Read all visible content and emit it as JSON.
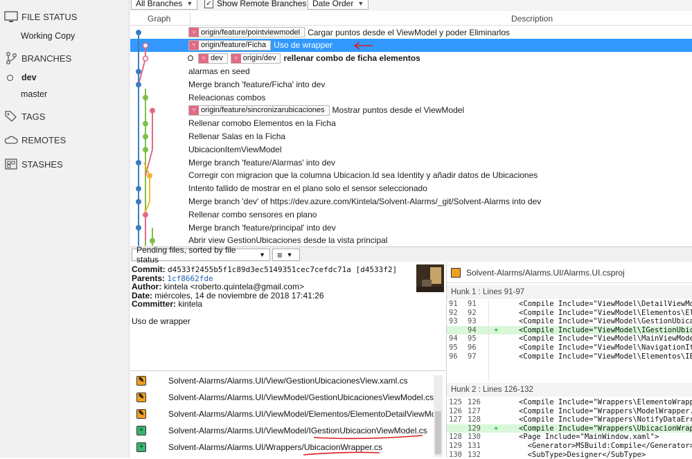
{
  "sidebar": {
    "file_status": "FILE STATUS",
    "working_copy": "Working Copy",
    "branches": "BRANCHES",
    "branch_dev": "dev",
    "branch_master": "master",
    "tags": "TAGS",
    "remotes": "REMOTES",
    "stashes": "STASHES"
  },
  "toolbar": {
    "branches_filter": "All Branches",
    "show_remote": "Show Remote Branches",
    "order": "Date Order"
  },
  "history": {
    "col_graph": "Graph",
    "col_description": "Description",
    "rows": [
      {
        "tags": [
          "origin/feature/pointviewmodel"
        ],
        "text": "Cargar puntos desde el ViewModel y poder Eliminarlos"
      },
      {
        "tags": [
          "origin/feature/Ficha"
        ],
        "text": "Uso de wrapper"
      },
      {
        "tags": [
          "dev",
          "origin/dev"
        ],
        "text": "rellenar combo de ficha elementos"
      },
      {
        "tags": [],
        "text": "alarmas en seed"
      },
      {
        "tags": [],
        "text": "Merge branch 'feature/Ficha' into dev"
      },
      {
        "tags": [],
        "text": "Releacionas combos"
      },
      {
        "tags": [
          "origin/feature/sincronizarubicaciones"
        ],
        "text": "Mostrar puntos desde el ViewModel"
      },
      {
        "tags": [],
        "text": "Rellenar comobo Elementos en la Ficha"
      },
      {
        "tags": [],
        "text": "Rellenar Salas en la Ficha"
      },
      {
        "tags": [],
        "text": "UbicacionItemViewModel"
      },
      {
        "tags": [],
        "text": "Merge branch 'feature/Alarmas' into dev"
      },
      {
        "tags": [],
        "text": "Corregir con migracion que la columna Ubicacion.Id sea Identity y añadir datos de Ubicaciones"
      },
      {
        "tags": [],
        "text": "Intento fallido de mostrar en el plano solo el sensor seleccionado"
      },
      {
        "tags": [],
        "text": "Merge branch 'dev' of https://dev.azure.com/Kintela/Solvent-Alarms/_git/Solvent-Alarms into dev"
      },
      {
        "tags": [],
        "text": "Rellenar combo sensores en plano"
      },
      {
        "tags": [],
        "text": "Merge branch 'feature/principal' into dev"
      },
      {
        "tags": [],
        "text": "Abrir view GestionUbicaciones desde la vista principal"
      }
    ]
  },
  "bottom_bar": {
    "sort_label": "Pending files, sorted by file status",
    "view_icon": "list-icon"
  },
  "commit": {
    "commit_label": "Commit:",
    "commit_value": "d4533f2455b5f1c89d3ec5149351cec7cefdc71a [d4533f2]",
    "parents_label": "Parents:",
    "parents_value": "1cf8662fde",
    "author_label": "Author:",
    "author_value": "kintela <roberto.quintela@gmail.com>",
    "date_label": "Date:",
    "date_value": "miércoles, 14 de noviembre de 2018 17:41:26",
    "committer_label": "Committer:",
    "committer_value": "kintela",
    "message": "Uso de wrapper"
  },
  "files": [
    {
      "status": "modified",
      "path": "Solvent-Alarms/Alarms.UI/View/GestionUbicacionesView.xaml.cs"
    },
    {
      "status": "modified",
      "path": "Solvent-Alarms/Alarms.UI/ViewModel/GestionUbicacionesViewModel.cs"
    },
    {
      "status": "modified",
      "path": "Solvent-Alarms/Alarms.UI/ViewModel/Elementos/ElementoDetailViewMo"
    },
    {
      "status": "added",
      "path": "Solvent-Alarms/Alarms.UI/ViewModel/IGestionUbicacionViewModel.cs"
    },
    {
      "status": "added",
      "path": "Solvent-Alarms/Alarms.UI/Wrappers/UbicacionWrapper.cs"
    }
  ],
  "diff": {
    "file": "Solvent-Alarms/Alarms.UI/Alarms.UI.csproj",
    "hunk1": "Hunk 1 : Lines 91-97",
    "hunk1_lines": [
      {
        "o": "91",
        "n": "91",
        "pm": "",
        "code": "<Compile Include=\"ViewModel\\DetailViewMode",
        "add": false
      },
      {
        "o": "92",
        "n": "92",
        "pm": "",
        "code": "<Compile Include=\"ViewModel\\Elementos\\Elem",
        "add": false
      },
      {
        "o": "93",
        "n": "93",
        "pm": "",
        "code": "<Compile Include=\"ViewModel\\GestionUbicaci",
        "add": false
      },
      {
        "o": "",
        "n": "94",
        "pm": "+",
        "code": "<Compile Include=\"ViewModel\\IGestionUbica",
        "add": true
      },
      {
        "o": "94",
        "n": "95",
        "pm": "",
        "code": "<Compile Include=\"ViewModel\\MainViewModel.",
        "add": false
      },
      {
        "o": "95",
        "n": "96",
        "pm": "",
        "code": "<Compile Include=\"ViewModel\\NavigationItem",
        "add": false
      },
      {
        "o": "96",
        "n": "97",
        "pm": "",
        "code": "<Compile Include=\"ViewModel\\Elementos\\IEle",
        "add": false
      }
    ],
    "hunk2": "Hunk 2 : Lines 126-132",
    "hunk2_lines": [
      {
        "o": "125",
        "n": "126",
        "pm": "",
        "code": "<Compile Include=\"Wrappers\\ElementoWrapper",
        "add": false
      },
      {
        "o": "126",
        "n": "127",
        "pm": "",
        "code": "<Compile Include=\"Wrappers\\ModelWrapper.cs",
        "add": false
      },
      {
        "o": "127",
        "n": "128",
        "pm": "",
        "code": "<Compile Include=\"Wrappers\\NotifyDataError",
        "add": false
      },
      {
        "o": "",
        "n": "129",
        "pm": "+",
        "code": "<Compile Include=\"Wrappers\\UbicacionWrappe",
        "add": true
      },
      {
        "o": "128",
        "n": "130",
        "pm": "",
        "code": "<Page Include=\"MainWindow.xaml\">",
        "add": false
      },
      {
        "o": "129",
        "n": "131",
        "pm": "",
        "code": "  <Generator>MSBuild:Compile</Generator>",
        "add": false
      },
      {
        "o": "130",
        "n": "132",
        "pm": "",
        "code": "  <SubType>Designer</SubType>",
        "add": false
      }
    ]
  },
  "colors": {
    "selection": "#3399ff",
    "branch_blue": "#3b7dc4",
    "branch_pink": "#e06b84",
    "branch_green": "#7cbf4a",
    "branch_orange": "#f2b632",
    "annotation_red": "#d91c1c"
  }
}
